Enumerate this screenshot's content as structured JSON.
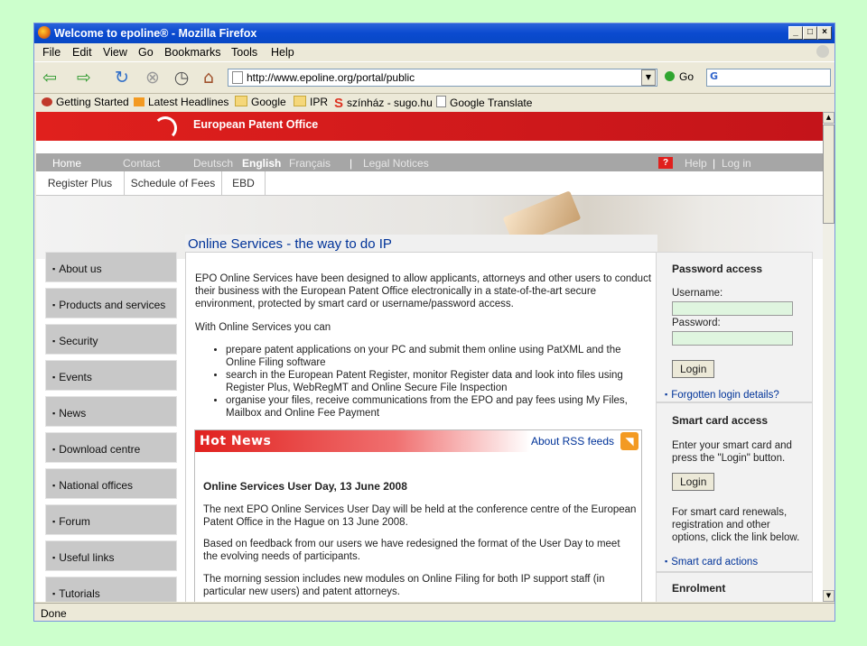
{
  "window": {
    "title": "Welcome to epoline® - Mozilla Firefox",
    "minimize": "_",
    "maximize": "□",
    "close": "×"
  },
  "menubar": {
    "items": [
      "File",
      "Edit",
      "View",
      "Go",
      "Bookmarks",
      "Tools",
      "Help"
    ]
  },
  "navbar": {
    "url": "http://www.epoline.org/portal/public",
    "go_label": "Go",
    "icons": [
      "back-arrow-icon",
      "forward-arrow-icon",
      "reload-icon",
      "stop-icon",
      "history-icon",
      "home-icon"
    ]
  },
  "bookmarks": [
    "Getting Started",
    "Latest Headlines",
    "Google",
    "IPR",
    "színház - sugo.hu",
    "Google Translate"
  ],
  "epo": {
    "banner_title": "European Patent Office",
    "topnav": {
      "home": "Home",
      "contact": "Contact",
      "deutsch": "Deutsch",
      "english": "English",
      "francais": "Français",
      "sep": "|",
      "legal": "Legal Notices",
      "help": "Help",
      "login": "Log in",
      "help_icon": "?"
    },
    "subnav": [
      "Register Plus",
      "Schedule of Fees",
      "EBD"
    ],
    "headline": "Online Services - the way to do IP",
    "leftnav": [
      "About us",
      "Products and services",
      "Security",
      "Events",
      "News",
      "Download centre",
      "National offices",
      "Forum",
      "Useful links",
      "Tutorials"
    ],
    "main": {
      "intro": "EPO Online Services have been designed to allow applicants, attorneys and other users to conduct their business with the European Patent Office electronically in a state-of-the-art secure environment, protected by smart card or username/password access.",
      "with_label": "With Online Services you can",
      "bullets": [
        "prepare patent applications on your PC and submit them online using PatXML and the Online Filing software",
        "search in the European Patent Register, monitor Register data and look into files using Register Plus, WebRegMT and Online Secure File Inspection",
        "organise your files, receive communications from the EPO and pay fees using My Files, Mailbox and Online Fee Payment"
      ]
    },
    "hotnews": {
      "title": "Hot News",
      "rss_link": "About RSS feeds",
      "item_title": "Online Services User Day, 13 June 2008",
      "p1": "The next EPO Online Services User Day will be held at the conference centre of the European Patent Office in the Hague on 13 June 2008.",
      "p2": "Based on feedback from our users we have redesigned the format of the User Day to meet the evolving needs of participants.",
      "p3": "The morning session includes new modules on Online Filing for both IP support staff (in particular new users) and patent attorneys."
    },
    "right": {
      "password_heading": "Password access",
      "username_label": "Username:",
      "password_label": "Password:",
      "login_button": "Login",
      "forgot_link": "Forgotten login details?",
      "smart_heading": "Smart card access",
      "smart_text": "Enter your smart card and press the \"Login\" button.",
      "smart_login_button": "Login",
      "renew_text": "For smart card renewals, registration and other options, click the link below.",
      "smart_actions_link": "Smart card actions",
      "enrolment_heading": "Enrolment"
    }
  },
  "status": {
    "text": "Done"
  }
}
